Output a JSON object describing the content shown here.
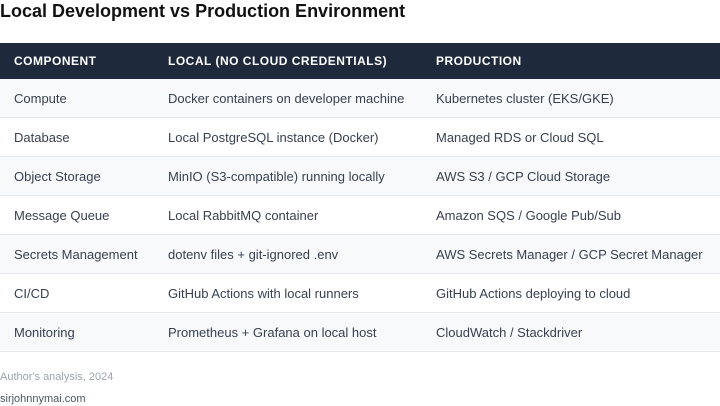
{
  "title": "Local Development vs Production Environment",
  "table": {
    "headers": [
      "COMPONENT",
      "LOCAL (NO CLOUD CREDENTIALS)",
      "PRODUCTION"
    ],
    "rows": [
      [
        "Compute",
        "Docker containers on developer machine",
        "Kubernetes cluster (EKS/GKE)"
      ],
      [
        "Database",
        "Local PostgreSQL instance (Docker)",
        "Managed RDS or Cloud SQL"
      ],
      [
        "Object Storage",
        "MinIO (S3-compatible) running locally",
        "AWS S3 / GCP Cloud Storage"
      ],
      [
        "Message Queue",
        "Local RabbitMQ container",
        "Amazon SQS / Google Pub/Sub"
      ],
      [
        "Secrets Management",
        "dotenv files + git-ignored .env",
        "AWS Secrets Manager / GCP Secret Manager"
      ],
      [
        "CI/CD",
        "GitHub Actions with local runners",
        "GitHub Actions deploying to cloud"
      ],
      [
        "Monitoring",
        "Prometheus + Grafana on local host",
        "CloudWatch / Stackdriver"
      ]
    ]
  },
  "source": "Author's analysis, 2024",
  "credit": "sirjohnnymai.com",
  "colors": {
    "header_bg": "#1e293b",
    "header_text": "#ffffff",
    "row_alt_bg": "#f8f9fa",
    "row_bg": "#ffffff",
    "border": "#e5e7eb"
  }
}
